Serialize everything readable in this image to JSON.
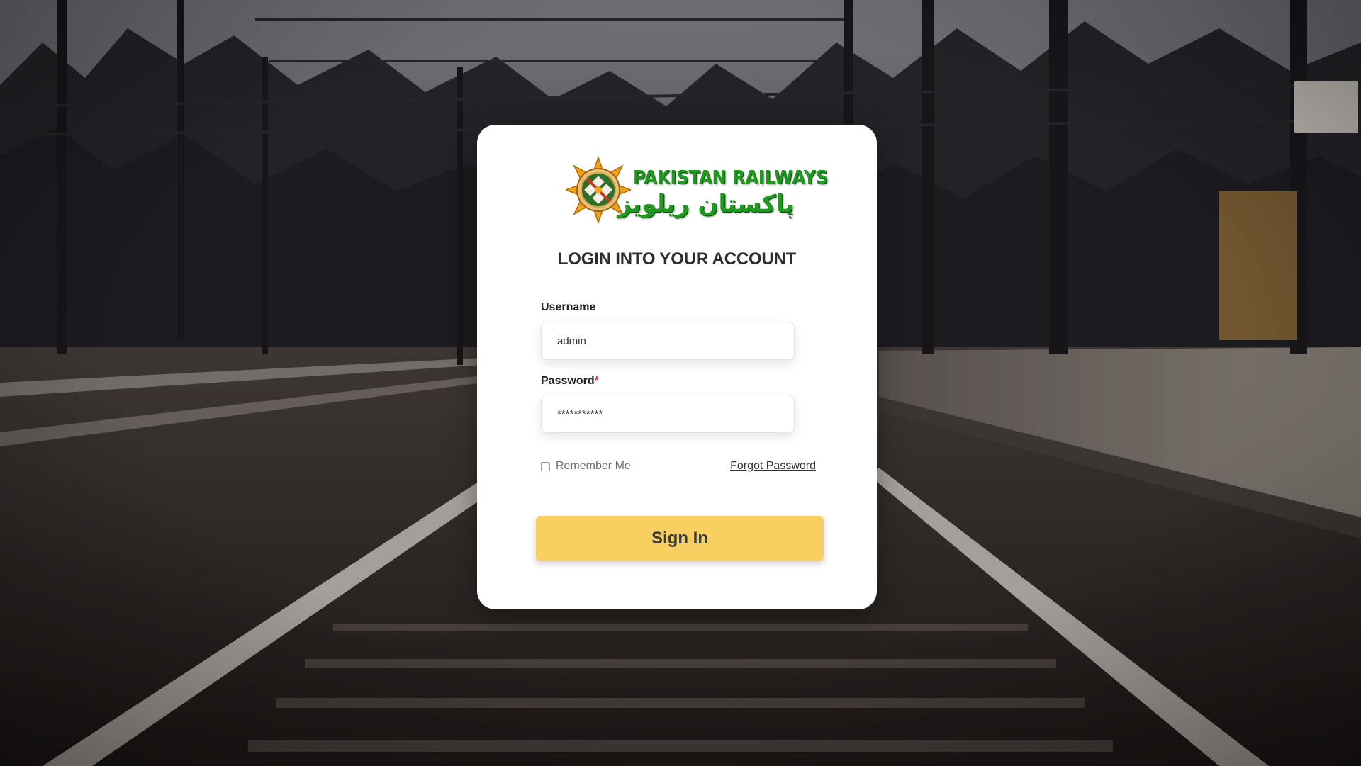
{
  "brand": {
    "name_en": "PAKISTAN RAILWAYS",
    "name_ur": "پاکستان ریلویز",
    "logo_icon": "pakistan-railways-emblem",
    "brand_green": "#1e9a1e"
  },
  "login": {
    "title": "LOGIN INTO YOUR ACCOUNT",
    "username_label": "Username",
    "username_value": "admin",
    "password_label": "Password",
    "password_required_mark": "*",
    "password_value": "***********",
    "remember_label": "Remember Me",
    "remember_checked": false,
    "forgot_label": "Forgot Password",
    "signin_label": "Sign In"
  },
  "colors": {
    "button": "#f8d062",
    "required": "#d62b2b"
  }
}
